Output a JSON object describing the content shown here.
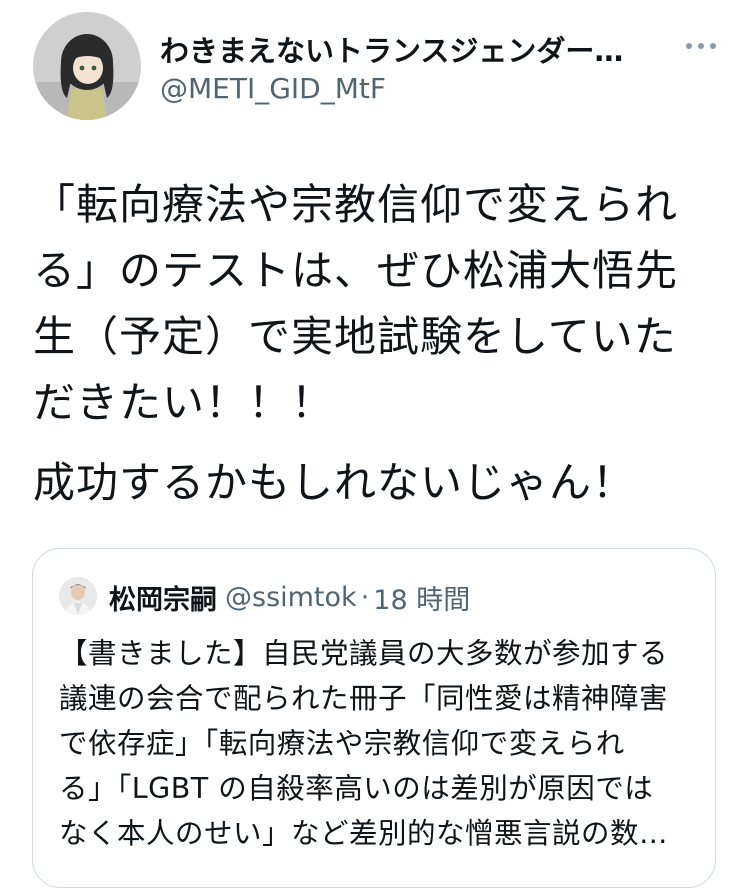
{
  "author": {
    "display_name": "わきまえないトランスジェンダー…",
    "handle": "@METI_GID_MtF",
    "avatar": "figure-avatar"
  },
  "menu": {
    "icon": "more-horizontal-icon"
  },
  "tweet": {
    "lines": [
      "「転向療法や宗教信仰で変えられ",
      "る」のテストは、ぜひ松浦大悟先",
      "生（予定）で実地試験をしていた",
      "だきたい！！！"
    ],
    "line2": "成功するかもしれないじゃん！"
  },
  "quote": {
    "display_name": "松岡宗嗣",
    "handle": "@ssimtok",
    "separator": "·",
    "time": "18 時間",
    "lines": [
      "【書きました】自民党議員の大多数が参加する",
      "議連の会合で配られた冊子「同性愛は精神障害",
      "で依存症」「転向療法や宗教信仰で変えられ",
      "る」「LGBT の自殺率高いのは差別が原因では",
      "なく本人のせい」など差別的な憎悪言説の数…"
    ]
  },
  "colors": {
    "text": "#0f1419",
    "secondary": "#536471",
    "border": "#cfd9de"
  }
}
